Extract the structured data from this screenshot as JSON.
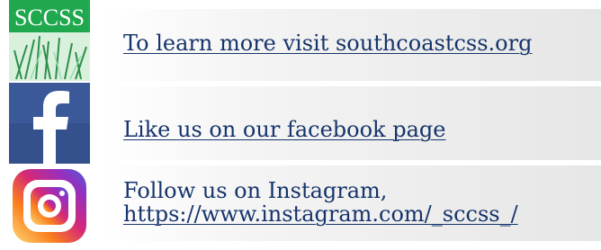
{
  "rows": [
    {
      "icon": "sccss-logo-icon",
      "logo_text": "SCCSS",
      "text": "To learn more visit southcoastcss.org"
    },
    {
      "icon": "facebook-icon",
      "text": "Like us on our facebook page"
    },
    {
      "icon": "instagram-icon",
      "text": "Follow us on Instagram,",
      "link": "https://www.instagram.com/_sccss_/"
    }
  ],
  "colors": {
    "link_text": "#16346b",
    "sccss_green": "#1fa84e",
    "facebook_blue": "#3b5998"
  }
}
